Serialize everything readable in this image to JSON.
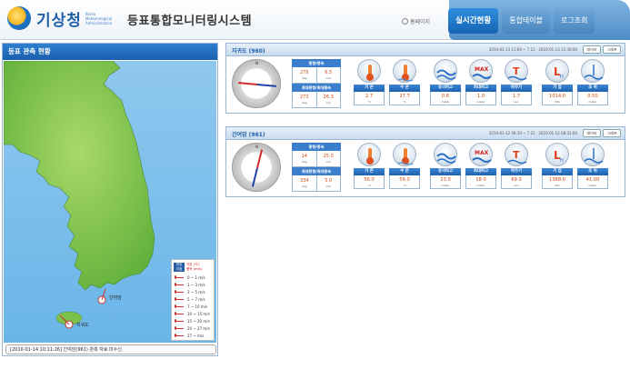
{
  "header": {
    "org_name": "기상청",
    "org_sub": "Korea Meteorological Administration",
    "system_title": "등표통합모니터링시스템",
    "home_label": "홈페이지",
    "tabs": [
      {
        "label": "실시간현황",
        "active": true
      },
      {
        "label": "통합테이블",
        "active": false
      },
      {
        "label": "로그조회",
        "active": false
      }
    ]
  },
  "left": {
    "title": "등표 관측 현황",
    "markers": [
      {
        "label": "간여암"
      },
      {
        "label": "지귀도"
      }
    ],
    "legend": {
      "badge_top": "번호",
      "badge_bottom": "지점",
      "value_top": "기온 (℃)",
      "value_bottom": "풍속 (m/s)",
      "rows": [
        "0 ~ 1 m/s",
        "1 ~ 3 m/s",
        "3 ~ 5 m/s",
        "5 ~ 7 m/s",
        "7 ~ 10 m/s",
        "10 ~ 15 m/s",
        "15 ~ 20 m/s",
        "20 ~ 27 m/s",
        "27 ~ m/s"
      ]
    },
    "status_text": "[2010-01-14 10:11:26] 간여암(961) 관측 자료 미수신."
  },
  "stations": [
    {
      "name": "지귀도 (960)",
      "time_text": "2010-01-13 11:00 ~ 7 21 · 2010-01-13 11:30:00",
      "btn_data": "데이터",
      "btn_graph": "그래프",
      "compass_n": "N",
      "wind": {
        "title1": "풍향/풍속",
        "dir": "275",
        "dir_unit": "deg",
        "spd": "6.5",
        "spd_unit": "m/s",
        "title2": "최대풍향/최대풍속",
        "mdir": "273",
        "mdir_unit": "deg",
        "mspd": "26.3",
        "mspd_unit": "m/s"
      },
      "gauges": [
        {
          "label": "기 온",
          "value": "2.7",
          "unit": "°C"
        },
        {
          "label": "수 온",
          "value": "27.7",
          "unit": "°C"
        },
        {
          "label": "유의파고",
          "value": "0.6",
          "unit": "meter"
        },
        {
          "label": "최대파고",
          "value": "1.0",
          "unit": "meter"
        },
        {
          "label": "파주기",
          "value": "1.7",
          "unit": "sec"
        },
        {
          "label": "기 압",
          "value": "1014.0",
          "unit": "hPa"
        },
        {
          "label": "조 위",
          "value": "0.50",
          "unit": "meter"
        }
      ]
    },
    {
      "name": "간여암 (961)",
      "time_text": "2010-01-12 08:30 ~ 7 21 · 2010-01-12 08:31:00",
      "btn_data": "데이터",
      "btn_graph": "그래프",
      "compass_n": "N",
      "wind": {
        "title1": "풍향/풍속",
        "dir": "14",
        "dir_unit": "deg",
        "spd": "25.0",
        "spd_unit": "m/s",
        "title2": "최대풍향/최대풍속",
        "mdir": "334",
        "mdir_unit": "deg",
        "mspd": "5.0",
        "mspd_unit": "m/s"
      },
      "gauges": [
        {
          "label": "기 온",
          "value": "56.0",
          "unit": "°C"
        },
        {
          "label": "수 온",
          "value": "59.0",
          "unit": "°C"
        },
        {
          "label": "유의파고",
          "value": "23.0",
          "unit": "meter"
        },
        {
          "label": "최대파고",
          "value": "18.0",
          "unit": "meter"
        },
        {
          "label": "파주기",
          "value": "69.0",
          "unit": "sec"
        },
        {
          "label": "기 압",
          "value": "1368.0",
          "unit": "hPa"
        },
        {
          "label": "조 위",
          "value": "41.00",
          "unit": "meter"
        }
      ]
    }
  ]
}
